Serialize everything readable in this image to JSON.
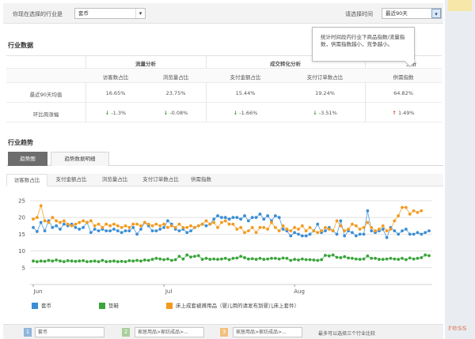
{
  "filter": {
    "industry_label": "你现在选择的行业是",
    "industry_value": "套币",
    "time_label": "请选择时间",
    "time_value": "最近90天"
  },
  "industry_data": {
    "title": "行业数据",
    "groups": [
      "流量分析",
      "成交转化分析",
      "分析"
    ],
    "columns": [
      "访客数占比",
      "浏览量占比",
      "支付金额占比",
      "支付订单数占比",
      "供需指数"
    ],
    "avg_label": "最近90天均值",
    "avg_values": [
      "16.65%",
      "23.75%",
      "15.44%",
      "19.24%",
      "64.82%"
    ],
    "change_label": "环比周涨幅",
    "change_values": [
      "-1.3%",
      "-0.08%",
      "-1.66%",
      "-3.51%",
      "1.49%"
    ],
    "change_dirs": [
      "down",
      "down",
      "down",
      "down",
      "up"
    ]
  },
  "tooltip": {
    "text": "统计时间段内行业下商品指数/流量指数，供需指数越小，竞争越小。"
  },
  "trend": {
    "title": "行业趋势",
    "view_tabs": [
      "趋势图",
      "趋势数据明细"
    ],
    "metric_tabs": [
      "访客数占比",
      "支付金额占比",
      "浏览量占比",
      "支付订单数占比",
      "供需指数"
    ],
    "legend": [
      "套币",
      "垫鞋",
      "床上成套被褥用品（婴儿用的请发布到婴儿床上套件）"
    ]
  },
  "compare": {
    "slots": [
      {
        "num": "1",
        "value": "套币",
        "color": "#8fb5db"
      },
      {
        "num": "2",
        "value": "家居用品>家纺成品>...",
        "color": "#a9cf9c"
      },
      {
        "num": "3",
        "value": "家居用品>家纺成品>...",
        "color": "#f1c07c"
      }
    ],
    "hint": "最多可以选择三个行业比较"
  },
  "watermark": "ress",
  "chart_data": {
    "type": "line",
    "x_ticks": [
      "Jun",
      "Jul",
      "Aug"
    ],
    "y_ticks": [
      5,
      10,
      15,
      20,
      25
    ],
    "ylim": [
      0,
      25
    ],
    "grid": true,
    "legend_placement": "bottom",
    "series": [
      {
        "name": "套币",
        "color": "#3b8ed6",
        "values": [
          17,
          15.8,
          18.5,
          16,
          19,
          17,
          17.5,
          16.5,
          18,
          17.5,
          18,
          17,
          16.5,
          17,
          18.5,
          15.5,
          16.5,
          16,
          16.5,
          16,
          16,
          16.5,
          16,
          15.5,
          16,
          16,
          17,
          15,
          16.5,
          18.5,
          17.5,
          16,
          16,
          16.5,
          17,
          19,
          18,
          16.5,
          16,
          16.5,
          15.5,
          16,
          17,
          17.5,
          18,
          17.5,
          18,
          19.5,
          20.5,
          20,
          20,
          19.5,
          20,
          20,
          19.5,
          20.5,
          19,
          20,
          20,
          21,
          19.5,
          20.5,
          19,
          20.5,
          20,
          16.5,
          16,
          14.5,
          15.5,
          15,
          14.5,
          14.5,
          15,
          16,
          18,
          15.5,
          16,
          17,
          16,
          15,
          19,
          14.5,
          16,
          15.5,
          14.5,
          15,
          15,
          22,
          16,
          15.5,
          16,
          16.5,
          14,
          17,
          16,
          15,
          16,
          16.5,
          15,
          15,
          15.5,
          15,
          15.5,
          16
        ]
      },
      {
        "name": "垫鞋",
        "color": "#3aa53a",
        "values": [
          7,
          6.8,
          7,
          6.9,
          7.2,
          7,
          7.3,
          7,
          6.8,
          7.1,
          7,
          6.9,
          7,
          7.1,
          6.8,
          6.9,
          7,
          6.8,
          7.2,
          6.8,
          6.9,
          7,
          6.8,
          6.9,
          6.8,
          7.1,
          7,
          7.2,
          7,
          7.3,
          7.2,
          7.5,
          7.8,
          7.6,
          7.4,
          7.6,
          7.2,
          7.4,
          8.4,
          7.6,
          8.8,
          8.2,
          8.4,
          8.6,
          7.5,
          7.8,
          7.5,
          7.6,
          7.5,
          7.6,
          7.8,
          7.4,
          7.8,
          7.9,
          8.4,
          8,
          7.6,
          7.7,
          7.5,
          7.8,
          7.5,
          7.6,
          7.8,
          7.8,
          7.6,
          7.9,
          7.8,
          7.2,
          7.5,
          7.3,
          7.6,
          7.4,
          7.4,
          7.3,
          7.2,
          7.4,
          8.7,
          8.5,
          8.8,
          8.1,
          8,
          8.3,
          7.9,
          7.8,
          7.6,
          7.5,
          7.6,
          8.5,
          7.8,
          7.8,
          7.5,
          7.5,
          7.6,
          7.8,
          7.6,
          7.5,
          7.8,
          7.4,
          7.9,
          7.6,
          7.8,
          8,
          8.8,
          8.6
        ]
      },
      {
        "name": "床上成套被褥用品（婴儿用的请发布到婴儿床上套件）",
        "color": "#f39a1e",
        "values": [
          19.5,
          20,
          23.5,
          19,
          18.5,
          20,
          19,
          18.5,
          19,
          18,
          17.5,
          18,
          18.5,
          19,
          18.5,
          19,
          17.5,
          18,
          17,
          18,
          17.5,
          18,
          17.5,
          17,
          17.5,
          17,
          18,
          18,
          17.5,
          18.5,
          18,
          17.5,
          18,
          17.5,
          18,
          17,
          17.5,
          17,
          18,
          17,
          17,
          17.5,
          17,
          17.5,
          18,
          19,
          18,
          18.5,
          17,
          18.5,
          19,
          18,
          18,
          16.5,
          17,
          15.5,
          16,
          17,
          15.5,
          17,
          17,
          16.5,
          18.5,
          17,
          16,
          17.5,
          16.5,
          16,
          17,
          16.5,
          17.5,
          16,
          17,
          16,
          15.5,
          16,
          17,
          16.5,
          16,
          19,
          17.5,
          16,
          16.5,
          18,
          17.5,
          16.5,
          17,
          18.5,
          17,
          16,
          16.5,
          17.5,
          16,
          16.5,
          19,
          20.5,
          23,
          23,
          21,
          22,
          21.5,
          22
        ]
      }
    ]
  }
}
